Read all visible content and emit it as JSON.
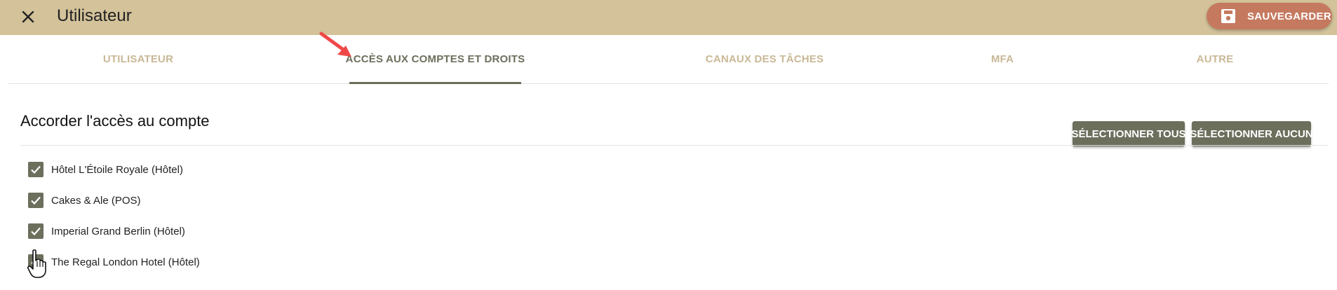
{
  "header": {
    "close_icon": "close-icon",
    "title": "Utilisateur",
    "save_label": "SAUVEGARDER",
    "save_icon": "floppy-disk-icon",
    "bg_color": "#d3c29a",
    "save_color": "#c5795f"
  },
  "tabs": [
    {
      "label": "UTILISATEUR",
      "active": false
    },
    {
      "label": "ACCÈS AUX COMPTES ET DROITS",
      "active": true
    },
    {
      "label": "CANAUX DES TÂCHES",
      "active": false
    },
    {
      "label": "MFA",
      "active": false
    },
    {
      "label": "AUTRE",
      "active": false
    }
  ],
  "section": {
    "title": "Accorder l'accès au compte",
    "select_all_label": "SÉLECTIONNER TOUS",
    "select_none_label": "SÉLECTIONNER AUCUN",
    "accent_color": "#6b6f5c"
  },
  "accounts": [
    {
      "label": "Hôtel L'Étoile Royale (Hôtel)",
      "checked": true
    },
    {
      "label": "Cakes & Ale (POS)",
      "checked": true
    },
    {
      "label": "Imperial Grand Berlin (Hôtel)",
      "checked": true
    },
    {
      "label": "The Regal London Hotel (Hôtel)",
      "checked": true
    }
  ],
  "annotation": {
    "arrow_icon": "red-arrow-icon",
    "arrow_color": "#f04848"
  },
  "cursor": {
    "icon": "hand-pointer-icon"
  }
}
